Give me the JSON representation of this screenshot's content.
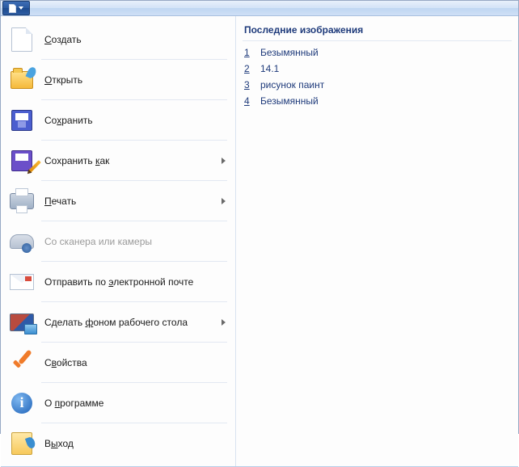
{
  "menu": {
    "new": "Создать",
    "open": "Открыть",
    "save": "Сохранить",
    "saveas": "Сохранить как",
    "print": "Печать",
    "scan": "Со сканера или камеры",
    "send": "Отправить по электронной почте",
    "wallpaper": "Сделать фоном рабочего стола",
    "props": "Свойства",
    "about": "О программе",
    "exit": "Выход"
  },
  "ul": {
    "new": "С",
    "open": "О",
    "save": "х",
    "saveas": "к",
    "print": "П",
    "send": "э",
    "wallpaper": "ф",
    "props": "в",
    "about": "п",
    "exit": "ы"
  },
  "recent": {
    "title": "Последние изображения",
    "items": [
      {
        "n": "1",
        "name": "Безымянный"
      },
      {
        "n": "2",
        "name": "14.1"
      },
      {
        "n": "3",
        "name": "рисунок паинт"
      },
      {
        "n": "4",
        "name": "Безымянный"
      }
    ]
  }
}
